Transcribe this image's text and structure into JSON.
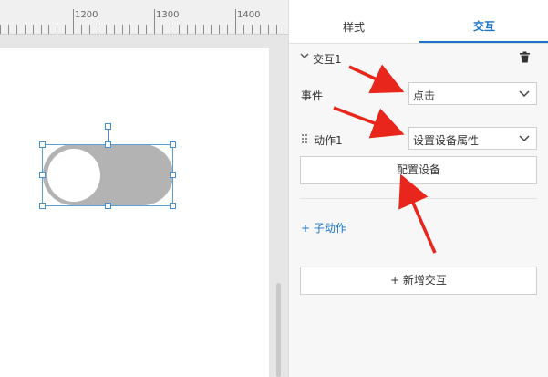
{
  "ruler": {
    "labels": [
      "1200",
      "1300",
      "1400"
    ]
  },
  "canvas": {
    "toggle": {
      "state": "off",
      "track_color": "#b3b3b3",
      "knob_color": "#ffffff"
    }
  },
  "panel": {
    "tabs": [
      {
        "label": "样式",
        "active": false
      },
      {
        "label": "交互",
        "active": true
      }
    ],
    "interaction": {
      "title": "交互1",
      "event_label": "事件",
      "event_value": "点击",
      "action_label": "动作1",
      "action_value": "设置设备属性",
      "configure_button": "配置设备",
      "sub_action_link": "+ 子动作",
      "add_interaction_button": "+ 新增交互"
    }
  },
  "colors": {
    "accent": "#1a73c8",
    "selection": "#3f8fd2",
    "annotation_arrow": "#e8261c"
  },
  "icons": [
    "chevron-down-icon",
    "trash-icon",
    "drag-grip-icon",
    "select-chevron-icon"
  ]
}
